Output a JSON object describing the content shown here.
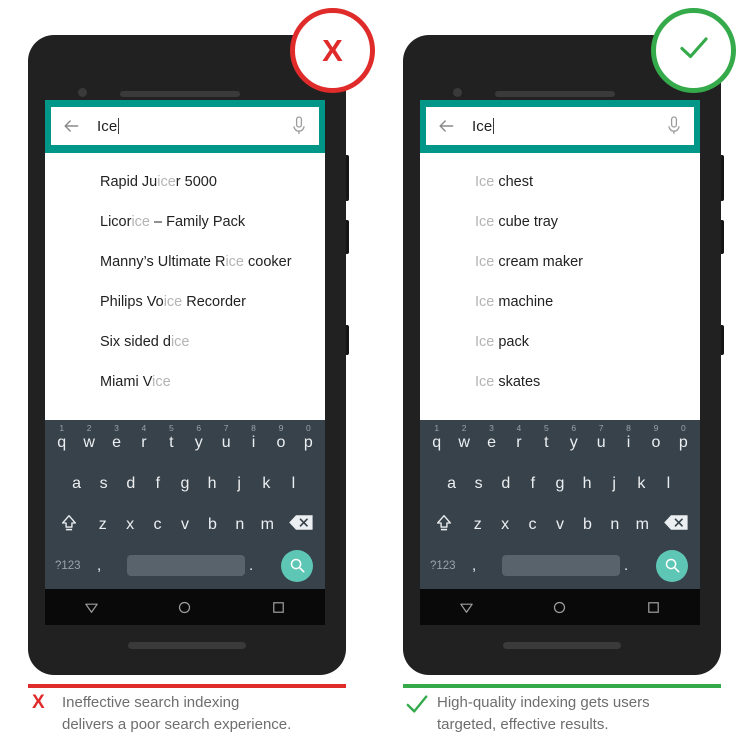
{
  "page": {
    "background": "#ffffff",
    "accent_teal": "#009688",
    "bad_color": "#e02b2b",
    "good_color": "#35aa4b"
  },
  "panels": {
    "bad": {
      "badge": {
        "icon": "x-mark-icon",
        "label": "X",
        "color": "#e02b2b"
      },
      "search": {
        "back_icon": "back-arrow-icon",
        "value": "Ice",
        "mic_icon": "microphone-icon"
      },
      "suggestions": [
        {
          "pre": "Rapid Ju",
          "match": "ice",
          "post": "r 5000"
        },
        {
          "pre": "Licor",
          "match": "ice",
          "post": " – Family Pack"
        },
        {
          "pre": "Manny’s Ultimate R",
          "match": "ice",
          "post": " cooker"
        },
        {
          "pre": "Philips Vo",
          "match": "ice",
          "post": " Recorder"
        },
        {
          "pre": "Six sided d",
          "match": "ice",
          "post": ""
        },
        {
          "pre": "Miami V",
          "match": "ice",
          "post": ""
        }
      ],
      "caption": {
        "mark": "X",
        "line1": "Ineffective search indexing",
        "line2": "delivers a poor search experience."
      }
    },
    "good": {
      "badge": {
        "icon": "check-mark-icon",
        "label": "✓",
        "color": "#35aa4b"
      },
      "search": {
        "back_icon": "back-arrow-icon",
        "value": "Ice",
        "mic_icon": "microphone-icon"
      },
      "suggestions": [
        {
          "pre": "",
          "match": "Ice",
          "post": " chest"
        },
        {
          "pre": "",
          "match": "Ice",
          "post": " cube tray"
        },
        {
          "pre": "",
          "match": "Ice",
          "post": " cream maker"
        },
        {
          "pre": "",
          "match": "Ice",
          "post": " machine"
        },
        {
          "pre": "",
          "match": "Ice",
          "post": " pack"
        },
        {
          "pre": "",
          "match": "Ice",
          "post": " skates"
        }
      ],
      "caption": {
        "mark": "✓",
        "line1": "High-quality indexing gets users",
        "line2": "targeted, effective results."
      }
    }
  },
  "keyboard": {
    "row1": [
      {
        "key": "q",
        "num": "1"
      },
      {
        "key": "w",
        "num": "2"
      },
      {
        "key": "e",
        "num": "3"
      },
      {
        "key": "r",
        "num": "4"
      },
      {
        "key": "t",
        "num": "5"
      },
      {
        "key": "y",
        "num": "6"
      },
      {
        "key": "u",
        "num": "7"
      },
      {
        "key": "i",
        "num": "8"
      },
      {
        "key": "o",
        "num": "9"
      },
      {
        "key": "p",
        "num": "0"
      }
    ],
    "row2": [
      "a",
      "s",
      "d",
      "f",
      "g",
      "h",
      "j",
      "k",
      "l"
    ],
    "row3": [
      "z",
      "x",
      "c",
      "v",
      "b",
      "n",
      "m"
    ],
    "shift_icon": "shift-icon",
    "delete_icon": "backspace-icon",
    "symbols_label": "?123",
    "comma_label": ",",
    "period_label": ".",
    "search_icon": "search-icon"
  },
  "navbar": {
    "back_icon": "nav-back-triangle-icon",
    "home_icon": "nav-home-circle-icon",
    "recents_icon": "nav-recents-square-icon"
  }
}
